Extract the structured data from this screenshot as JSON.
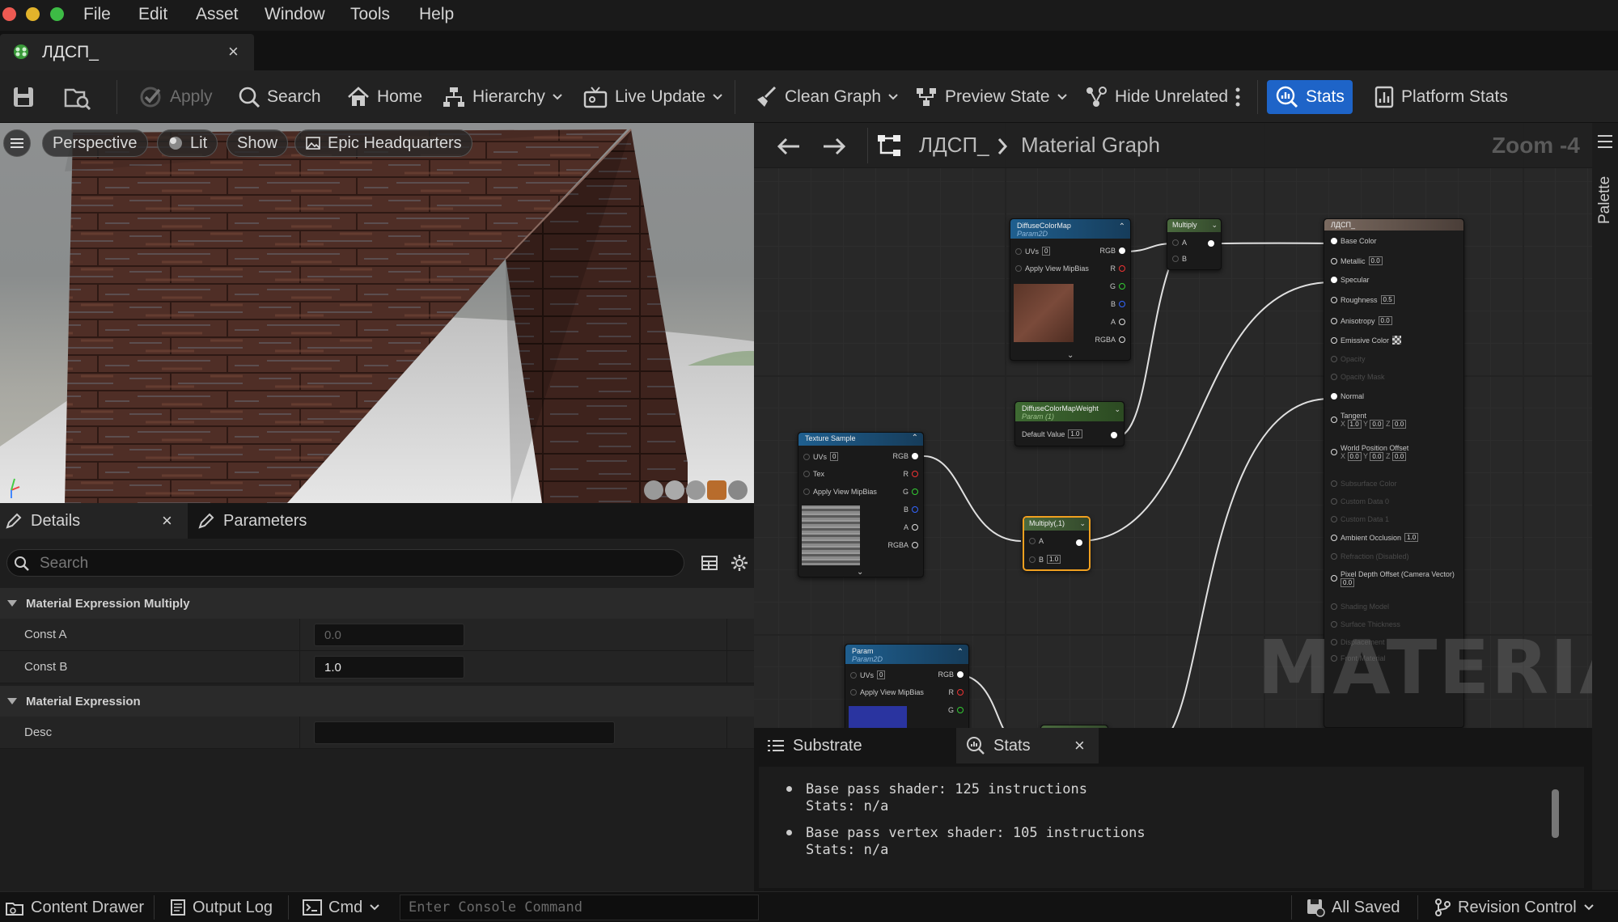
{
  "menu": [
    "File",
    "Edit",
    "Asset",
    "Window",
    "Tools",
    "Help"
  ],
  "document_tab": {
    "title": "ЛДСП_",
    "close": "×"
  },
  "toolbar": {
    "apply": "Apply",
    "search": "Search",
    "home": "Home",
    "hierarchy": "Hierarchy",
    "live_update": "Live Update",
    "clean_graph": "Clean Graph",
    "preview_state": "Preview State",
    "hide_unrelated": "Hide Unrelated",
    "stats": "Stats",
    "platform_stats": "Platform Stats"
  },
  "viewport": {
    "perspective": "Perspective",
    "lit": "Lit",
    "show": "Show",
    "environment": "Epic Headquarters"
  },
  "details": {
    "tab_details": "Details",
    "tab_parameters": "Parameters",
    "close": "×",
    "search_placeholder": "Search",
    "category_multiply": "Material Expression Multiply",
    "const_a_label": "Const A",
    "const_a_value": "0.0",
    "const_b_label": "Const B",
    "const_b_value": "1.0",
    "category_expression": "Material Expression",
    "desc_label": "Desc",
    "desc_value": ""
  },
  "graph": {
    "breadcrumb_root": "ЛДСП_",
    "breadcrumb_current": "Material Graph",
    "zoom": "Zoom -4",
    "watermark": "MATERIAL",
    "diffuse_node": {
      "title": "DiffuseColorMap",
      "subtitle": "Param2D",
      "uvs": "UVs",
      "uvs_val": "0",
      "mip": "Apply View MipBias",
      "pins": [
        "RGB",
        "R",
        "G",
        "B",
        "A",
        "RGBA"
      ]
    },
    "multiply_node": {
      "title": "Multiply",
      "a": "A",
      "b": "B"
    },
    "weight_node": {
      "title": "DiffuseColorMapWeight",
      "subtitle": "Param (1)",
      "default_label": "Default Value",
      "default_val": "1.0"
    },
    "texture_node": {
      "title": "Texture Sample",
      "uvs": "UVs",
      "uvs_val": "0",
      "tex": "Tex",
      "mip": "Apply View MipBias",
      "pins": [
        "RGB",
        "R",
        "G",
        "B",
        "A",
        "RGBA"
      ]
    },
    "multiply2_node": {
      "title": "Multiply(,1)",
      "a": "A",
      "b": "B",
      "b_val": "1.0"
    },
    "param_node": {
      "title": "Param",
      "subtitle": "Param2D",
      "uvs": "UVs",
      "uvs_val": "0",
      "mip": "Apply View MipBias",
      "pins": [
        "RGB",
        "R",
        "G"
      ]
    },
    "result_node": {
      "title": "ЛДСП_",
      "base_color": "Base Color",
      "metallic": "Metallic",
      "metallic_val": "0.0",
      "specular": "Specular",
      "roughness": "Roughness",
      "roughness_val": "0.5",
      "anisotropy": "Anisotropy",
      "anisotropy_val": "0.0",
      "emissive": "Emissive Color",
      "opacity": "Opacity",
      "opacity_mask": "Opacity Mask",
      "normal": "Normal",
      "tangent": "Tangent",
      "tangent_x": "1.0",
      "tangent_y": "0.0",
      "tangent_z": "0.0",
      "wpo": "World Position Offset",
      "wpo_x": "0.0",
      "wpo_y": "0.0",
      "wpo_z": "0.0",
      "subsurface": "Subsurface Color",
      "custom0": "Custom Data 0",
      "custom1": "Custom Data 1",
      "ao": "Ambient Occlusion",
      "ao_val": "1.0",
      "refraction": "Refraction (Disabled)",
      "pdo": "Pixel Depth Offset (Camera Vector)",
      "pdo_val": "0.0",
      "shading_model": "Shading Model",
      "surface_thickness": "Surface Thickness",
      "displacement": "Displacement",
      "front_material": "Front Material",
      "x": "X",
      "y": "Y",
      "z": "Z"
    }
  },
  "stats_panel": {
    "tab_substrate": "Substrate",
    "tab_stats": "Stats",
    "close": "×",
    "line1": "Base pass shader: 125 instructions",
    "line1b": "Stats: n/a",
    "line2": "Base pass vertex shader: 105 instructions",
    "line2b": "Stats: n/a"
  },
  "palette": {
    "label": "Palette"
  },
  "statusbar": {
    "content_drawer": "Content Drawer",
    "output_log": "Output Log",
    "cmd": "Cmd",
    "console_placeholder": "Enter Console Command",
    "all_saved": "All Saved",
    "revision_control": "Revision Control"
  },
  "colors": {
    "accent": "#1e64c8",
    "selected": "#f0a020",
    "wire": "#e0e0e0"
  }
}
